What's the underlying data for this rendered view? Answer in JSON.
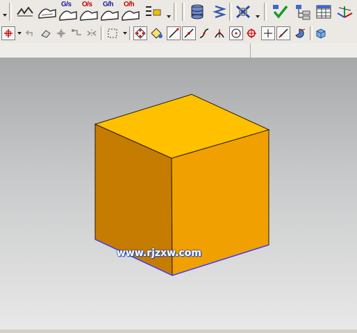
{
  "toolbar1": {
    "labels": {
      "gs": "G/s",
      "os": "O/s",
      "gh": "G/h",
      "oh": "O/h"
    }
  },
  "watermark": "www.rjzxw.com",
  "colors": {
    "cube_top": "#ffc000",
    "cube_front": "#f0a000",
    "cube_left": "#c87d00",
    "edge": "#3a2a00",
    "highlight_edge": "#3c3cff"
  }
}
